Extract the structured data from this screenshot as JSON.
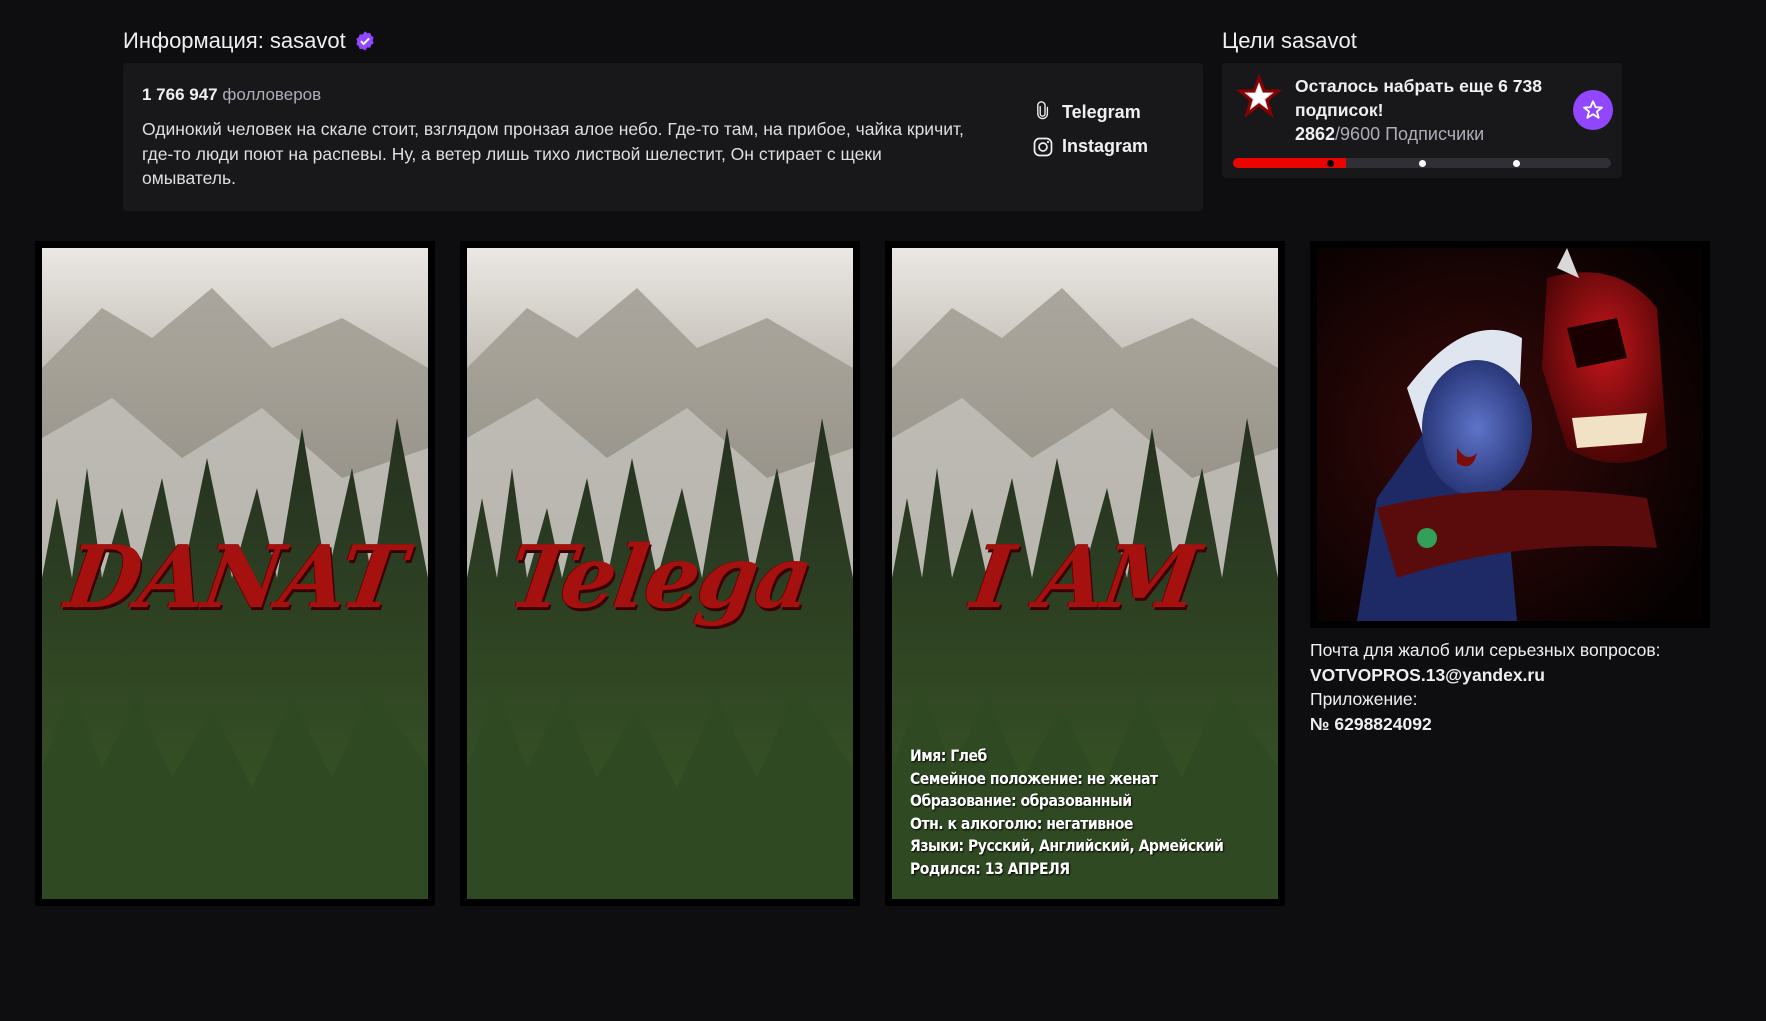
{
  "about": {
    "title": "Информация: sasavot",
    "followers_count": "1 766 947",
    "followers_label": "фолловеров",
    "description": "Одинокий человек на скале стоит, взглядом пронзая алое небо. Где-то там, на прибое, чайка кричит, где-то люди поют на распевы. Ну, а ветер лишь тихо листвой шелестит, Он стирает с щеки омыватель.",
    "social": [
      {
        "label": "Telegram",
        "icon": "telegram-icon"
      },
      {
        "label": "Instagram",
        "icon": "instagram-icon"
      }
    ]
  },
  "goals": {
    "title": "Цели sasavot",
    "goal_text": "Осталось набрать еще 6 738 подписок!",
    "current": "2862",
    "target": "/9600",
    "unit": "Подписчики",
    "progress": 0.298,
    "accent": "#9147ff",
    "bar_color": "#eb0400"
  },
  "panels": [
    {
      "title": "DANAT"
    },
    {
      "title": "Telega"
    },
    {
      "title": "I AM",
      "bio": [
        "Имя: Глеб",
        "Семейное положение: не женат",
        "Образование: образованный",
        "Отн. к алкоголю: негативное",
        "Языки: Русский, Английский, Армейский",
        "Родился: 13 АПРЕЛЯ"
      ]
    }
  ],
  "contact": {
    "label": "Почта для жалоб или серьезных вопросов:",
    "email": "VOTVOPROS.13@yandex.ru",
    "app_label": "Приложение:",
    "app_number": "№ 6298824092"
  }
}
